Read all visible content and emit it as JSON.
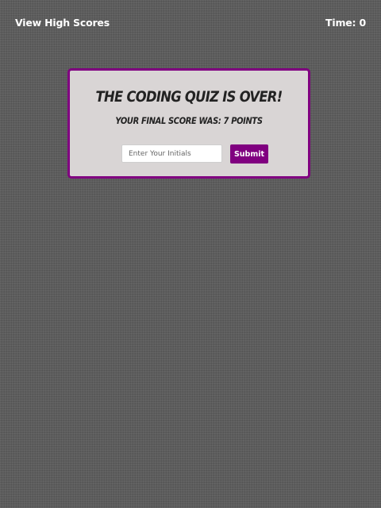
{
  "header": {
    "high_scores_link": "View High Scores",
    "timer_text": "Time: 0"
  },
  "result": {
    "title": "The Coding Quiz Is Over!",
    "score_text": "Your Final Score Was: 7 Points"
  },
  "form": {
    "initials_placeholder": "Enter Your Initials",
    "initials_value": "",
    "submit_label": "Submit"
  },
  "colors": {
    "accent": "#800080",
    "card_background": "#dcd8d8",
    "page_background": "#5b5b5b"
  }
}
